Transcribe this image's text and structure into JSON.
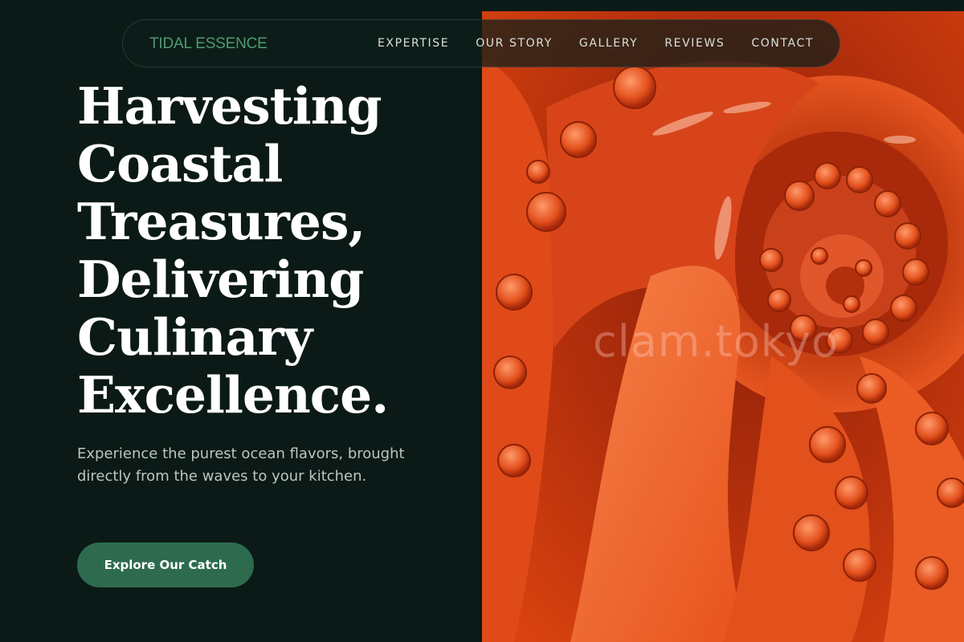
{
  "nav": {
    "brand": "TIDAL ESSENCE",
    "links": [
      "EXPERTISE",
      "OUR STORY",
      "GALLERY",
      "REVIEWS",
      "CONTACT"
    ]
  },
  "hero": {
    "headline_lines": [
      "Harvesting",
      "Coastal",
      "Treasures,",
      "Delivering",
      "Culinary",
      "Excellence."
    ],
    "subtext": "Experience the purest ocean flavors, brought directly from the waves to your kitchen.",
    "cta_label": "Explore Our Catch",
    "image_alt": "Close-up of a cooked octopus with curled tentacles",
    "watermark": "clam.tokyo"
  },
  "colors": {
    "background": "#0b1a17",
    "brand": "#4f9a6f",
    "cta": "#2e6b4e",
    "octopus": "#e0461a"
  }
}
